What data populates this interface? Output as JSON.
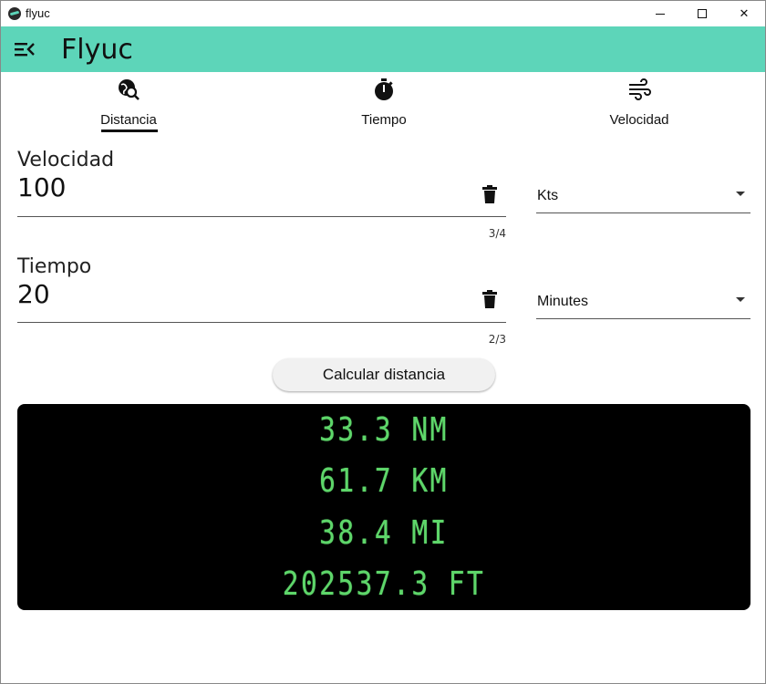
{
  "window": {
    "title": "flyuc",
    "controls": {
      "minimize_icon": "minimize-icon",
      "maximize_icon": "maximize-icon",
      "close_label": "✕"
    }
  },
  "appbar": {
    "title": "Flyuc",
    "menu_icon": "menu-collapse-icon",
    "color": "#5dd5b9"
  },
  "tabs": [
    {
      "label": "Distancia",
      "icon": "globe-search-icon",
      "selected": true
    },
    {
      "label": "Tiempo",
      "icon": "stopwatch-icon",
      "selected": false
    },
    {
      "label": "Velocidad",
      "icon": "wind-icon",
      "selected": false
    }
  ],
  "form": {
    "velocidad": {
      "label": "Velocidad",
      "value": "100",
      "counter": "3/4",
      "unit": "Kts"
    },
    "tiempo": {
      "label": "Tiempo",
      "value": "20",
      "counter": "2/3",
      "unit": "Minutes"
    },
    "calculate_label": "Calcular distancia"
  },
  "results": {
    "color": "#5ed66a",
    "lines": [
      "33.3 NM",
      "61.7 KM",
      "38.4 MI",
      "202537.3 FT"
    ]
  }
}
